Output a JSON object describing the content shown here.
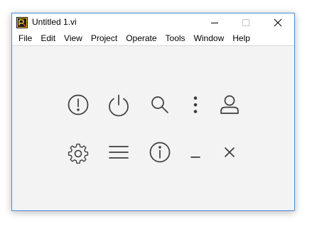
{
  "window": {
    "title": "Untitled 1.vi",
    "app_icon": "labview-vi-icon",
    "controls": {
      "minimize": "minimize-icon",
      "maximize": "maximize-icon",
      "close": "close-icon"
    },
    "accent_color": "#4a90d9"
  },
  "menubar": {
    "items": [
      {
        "label": "File"
      },
      {
        "label": "Edit"
      },
      {
        "label": "View"
      },
      {
        "label": "Project"
      },
      {
        "label": "Operate"
      },
      {
        "label": "Tools"
      },
      {
        "label": "Window"
      },
      {
        "label": "Help"
      }
    ]
  },
  "icons": {
    "row1": [
      "alert-circle-icon",
      "power-icon",
      "search-icon",
      "more-vertical-icon",
      "user-icon"
    ],
    "row2": [
      "settings-gear-icon",
      "menu-hamburger-icon",
      "info-circle-icon",
      "minimize-underscore-icon",
      "close-x-icon"
    ],
    "stroke_color": "#3c3c3c"
  }
}
